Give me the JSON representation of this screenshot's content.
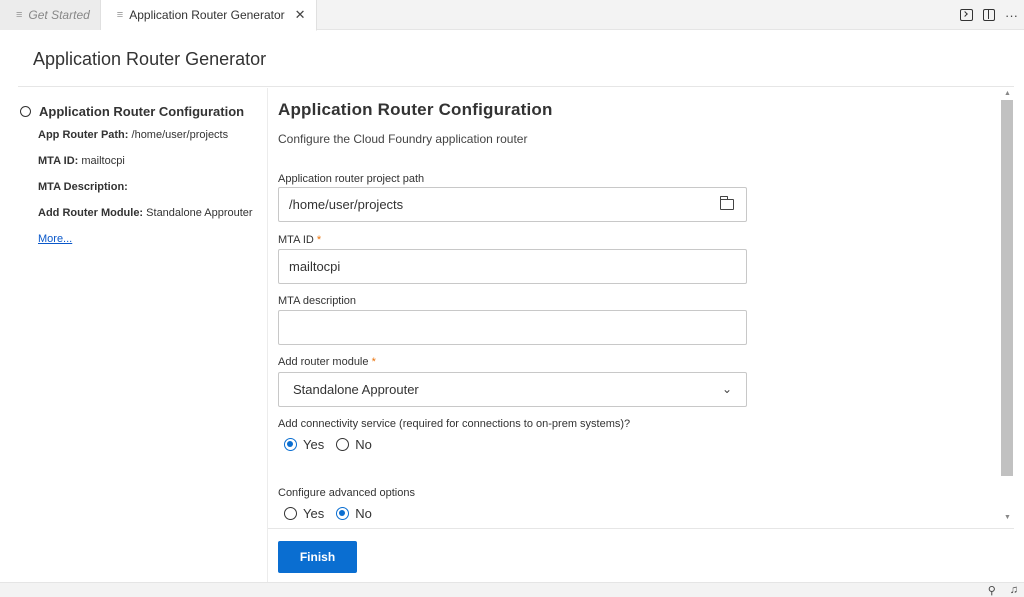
{
  "tabs": [
    {
      "label": "Get Started",
      "active": false
    },
    {
      "label": "Application Router Generator",
      "active": true
    }
  ],
  "tab_actions": {
    "more": "···"
  },
  "page": {
    "title": "Application Router Generator"
  },
  "sidebar": {
    "step_title": "Application Router Configuration",
    "summary": [
      {
        "key": "App Router Path:",
        "value": "/home/user/projects"
      },
      {
        "key": "MTA ID:",
        "value": "mailtocpi"
      },
      {
        "key": "MTA Description:",
        "value": ""
      },
      {
        "key": "Add Router Module:",
        "value": "Standalone Approuter"
      }
    ],
    "more_link": "More..."
  },
  "form": {
    "title": "Application Router Configuration",
    "subtitle": "Configure the Cloud Foundry application router",
    "path_label": "Application router project path",
    "path_value": "/home/user/projects",
    "mta_id_label": "MTA ID",
    "mta_id_value": "mailtocpi",
    "mta_desc_label": "MTA description",
    "mta_desc_value": "",
    "router_label": "Add router module",
    "router_value": "Standalone Approuter",
    "required_marker": "*",
    "connectivity_label": "Add connectivity service (required for connections to on-prem systems)?",
    "connectivity_options": [
      "Yes",
      "No"
    ],
    "connectivity_selected": "Yes",
    "advanced_label": "Configure advanced options",
    "advanced_options": [
      "Yes",
      "No"
    ],
    "advanced_selected": "No"
  },
  "footer": {
    "finish_label": "Finish"
  },
  "colors": {
    "accent": "#0a6ed1",
    "required": "#e9730c"
  }
}
